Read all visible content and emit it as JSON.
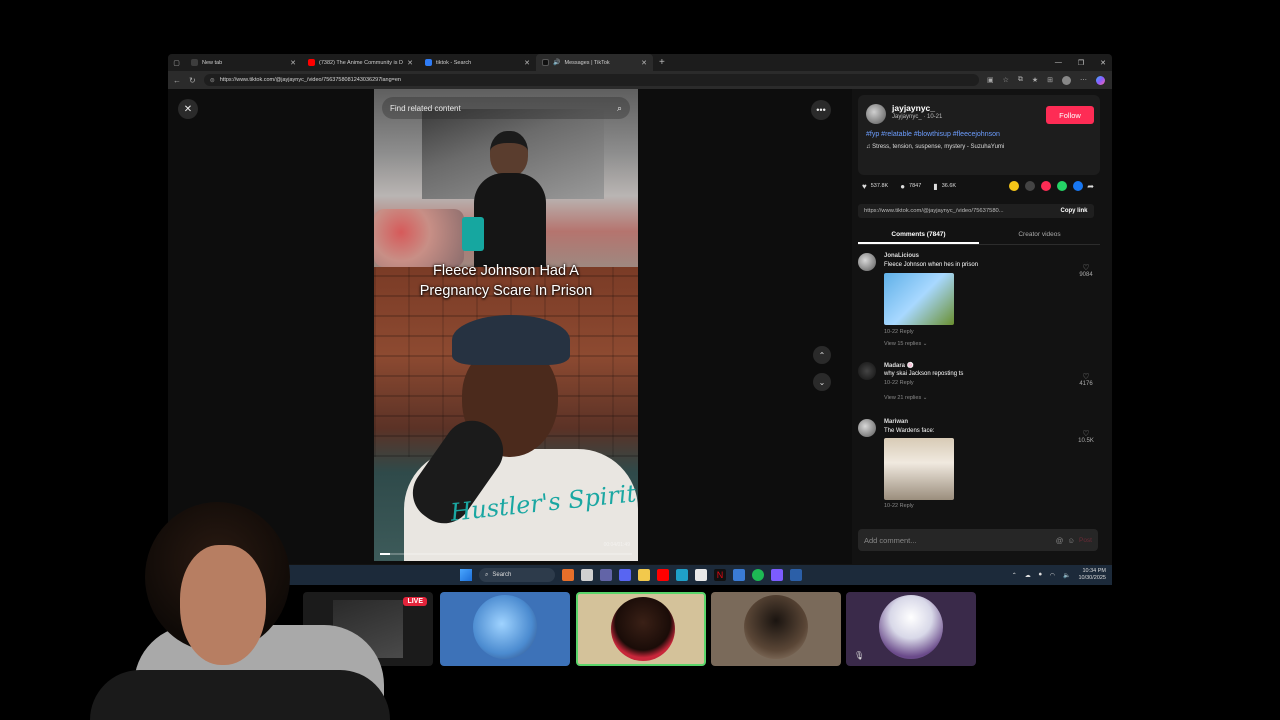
{
  "browser": {
    "tabs": [
      {
        "title": "New tab",
        "favicon_color": "#3d3d3d",
        "active": false
      },
      {
        "title": "(7382) The Anime Community is D...",
        "favicon_color": "#ff0000",
        "active": false
      },
      {
        "title": "tiktok - Search",
        "favicon_color": "#2f7cf6",
        "active": false
      },
      {
        "title": "Messages | TikTok",
        "favicon_color": "#111111",
        "active": true
      }
    ],
    "url": "https://www.tiktok.com/@jayjaynyc_/video/7563758081243036297lang=en"
  },
  "video": {
    "search_placeholder": "Find related content",
    "caption_line1": "Fleece Johnson Had A",
    "caption_line2": "Pregnancy Scare In Prison",
    "shirt_text": "Hustler's Spirit",
    "progress": 0.04,
    "time": "00:04/01:49"
  },
  "creator": {
    "name": "jayjaynyc_",
    "sub": "Jayjaynyc_ · 10-21",
    "follow_label": "Follow",
    "hashtags": "#fyp #relatable #blowthisup #fleecejohnson",
    "music": "Stress, tension, suspense, mystery - SuzuhaYumi"
  },
  "stats": {
    "likes": "537.8K",
    "comments": "7847",
    "saves": "36.6K"
  },
  "link": {
    "url": "https://www.tiktok.com/@jayjaynyc_/video/75637580...",
    "copy_label": "Copy link"
  },
  "panel_tabs": {
    "comments": "Comments (7847)",
    "creator_videos": "Creator videos"
  },
  "comments": [
    {
      "user": "JonaLicious",
      "text": "Fleece Johnson when hes in prison",
      "meta": "10-22    Reply",
      "replies": "View 15 replies ⌄",
      "likes": "9084"
    },
    {
      "user": "Madara 🍥",
      "text": "why skai Jackson reposting ts",
      "meta": "10-22    Reply",
      "replies": "View 21 replies ⌄",
      "likes": "4176"
    },
    {
      "user": "Mariwan",
      "text": "The Wardens face:",
      "meta": "10-22    Reply",
      "replies": "",
      "likes": "10.5K"
    }
  ],
  "comment_box": {
    "placeholder": "Add comment...",
    "post_label": "Post"
  },
  "taskbar": {
    "search_label": "Search",
    "time": "10:34 PM",
    "date": "10/30/2025"
  },
  "call": {
    "live_label": "LIVE"
  },
  "colors": {
    "accent": "#fe2c55",
    "hashtag": "#6d9eff",
    "active_tile": "#5ad46a"
  }
}
